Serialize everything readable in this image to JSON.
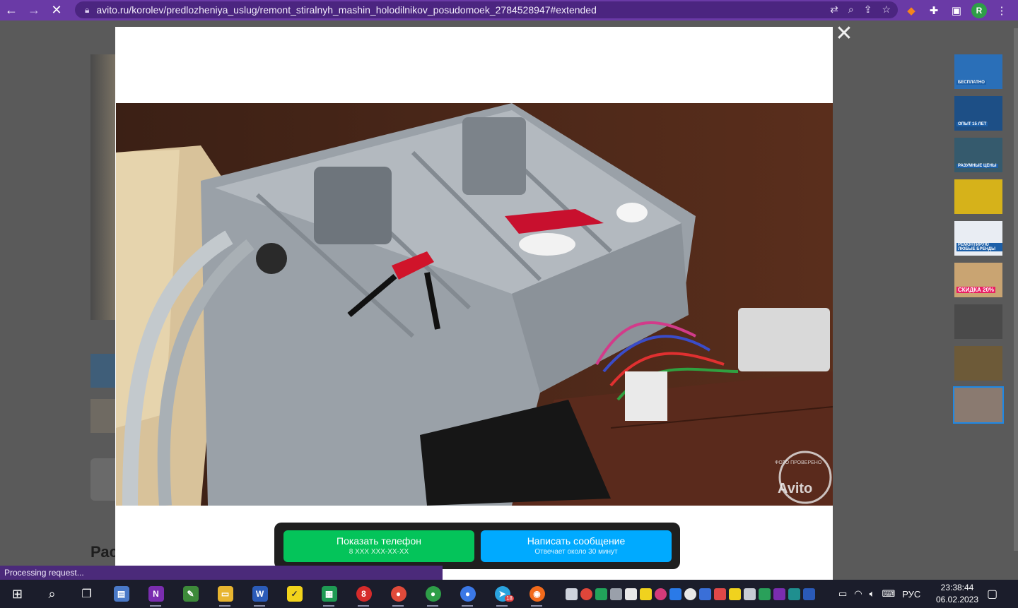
{
  "browser": {
    "url": "avito.ru/korolev/predlozheniya_uslug/remont_stiralnyh_mashin_holodilnikov_posudomoek_2784528947#extended",
    "avatar_letter": "R",
    "status_text": "Processing request..."
  },
  "page": {
    "heading_fragment": "Рас"
  },
  "photo": {
    "watermark": "Avito",
    "seal_text": "ФОТО ПРОВЕРЕНО"
  },
  "thumbnails": [
    {
      "caption": "БЕСПЛАТНО",
      "color": "#2a6fb8"
    },
    {
      "caption": "ОПЫТ 15 ЛЕТ",
      "color": "#1d4f86"
    },
    {
      "caption": "РАЗУМНЫЕ ЦЕНЫ",
      "color": "#355a6d"
    },
    {
      "caption": "",
      "color": "#d6b21a"
    },
    {
      "caption": "РЕМОНТИРУЮ ЛЮБЫЕ БРЕНДЫ",
      "color": "#2f4f9a"
    },
    {
      "caption": "СКИДКА 20%",
      "color": "#c9a472"
    },
    {
      "caption": "",
      "color": "#4a4a4a"
    },
    {
      "caption": "",
      "color": "#6d5a38"
    },
    {
      "caption": "",
      "color": "#8a7a70"
    }
  ],
  "cta": {
    "phone_label": "Показать телефон",
    "phone_sub": "8 XXX XXX-XX-XX",
    "message_label": "Написать сообщение",
    "message_sub": "Отвечает около 30 минут"
  },
  "taskbar": {
    "telegram_badge": "18",
    "lang": "РУС",
    "time": "23:38:44",
    "date": "06.02.2023"
  },
  "colors": {
    "browser_frame": "#6a3aa6",
    "green_button": "#04c45a",
    "blue_button": "#00aaff"
  }
}
